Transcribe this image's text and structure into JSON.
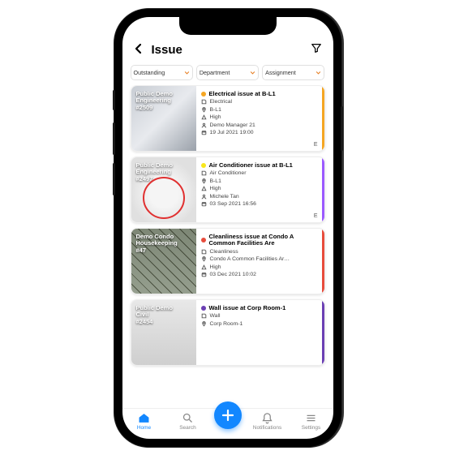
{
  "header": {
    "title": "Issue"
  },
  "filters": [
    {
      "label": "Outstanding"
    },
    {
      "label": "Department"
    },
    {
      "label": "Assignment"
    }
  ],
  "issues": [
    {
      "thumb_line1": "Public Demo",
      "thumb_line2": "Engineering",
      "thumb_id": "#2509",
      "status_color": "#f5a623",
      "stripe_color": "#f5a623",
      "title": "Electrical issue at B-L1",
      "category": "Electrical",
      "location": "B-L1",
      "priority": "High",
      "assignee": "Demo Manager 21",
      "datetime": "19 Jul 2021 19:00",
      "flag": "E"
    },
    {
      "thumb_line1": "Public Demo",
      "thumb_line2": "Engineering",
      "thumb_id": "#2497",
      "status_color": "#f8e71c",
      "stripe_color": "#9b59ff",
      "title": "Air Conditioner issue at B-L1",
      "category": "Air Conditioner",
      "location": "B-L1",
      "priority": "High",
      "assignee": "Michele Tan",
      "datetime": "03 Sep 2021 16:56",
      "flag": "E"
    },
    {
      "thumb_line1": "Demo Condo",
      "thumb_line2": "Housekeeping",
      "thumb_id": "#47",
      "status_color": "#e74c3c",
      "stripe_color": "#e74c3c",
      "title": "Cleanliness issue at Condo A Common Facilities Are",
      "category": "Cleanliness",
      "location": "Condo A Common Facilities Ar…",
      "priority": "High",
      "assignee": "",
      "datetime": "03 Dec 2021 10:02",
      "flag": ""
    },
    {
      "thumb_line1": "Public Demo",
      "thumb_line2": "Civil",
      "thumb_id": "#2454",
      "status_color": "#6b3fb3",
      "stripe_color": "#6b3fb3",
      "title": "Wall issue at Corp Room-1",
      "category": "Wall",
      "location": "Corp Room-1",
      "priority": "",
      "assignee": "",
      "datetime": "",
      "flag": ""
    }
  ],
  "nav": {
    "home": "Home",
    "search": "Search",
    "notifications": "Notifications",
    "settings": "Settings"
  }
}
